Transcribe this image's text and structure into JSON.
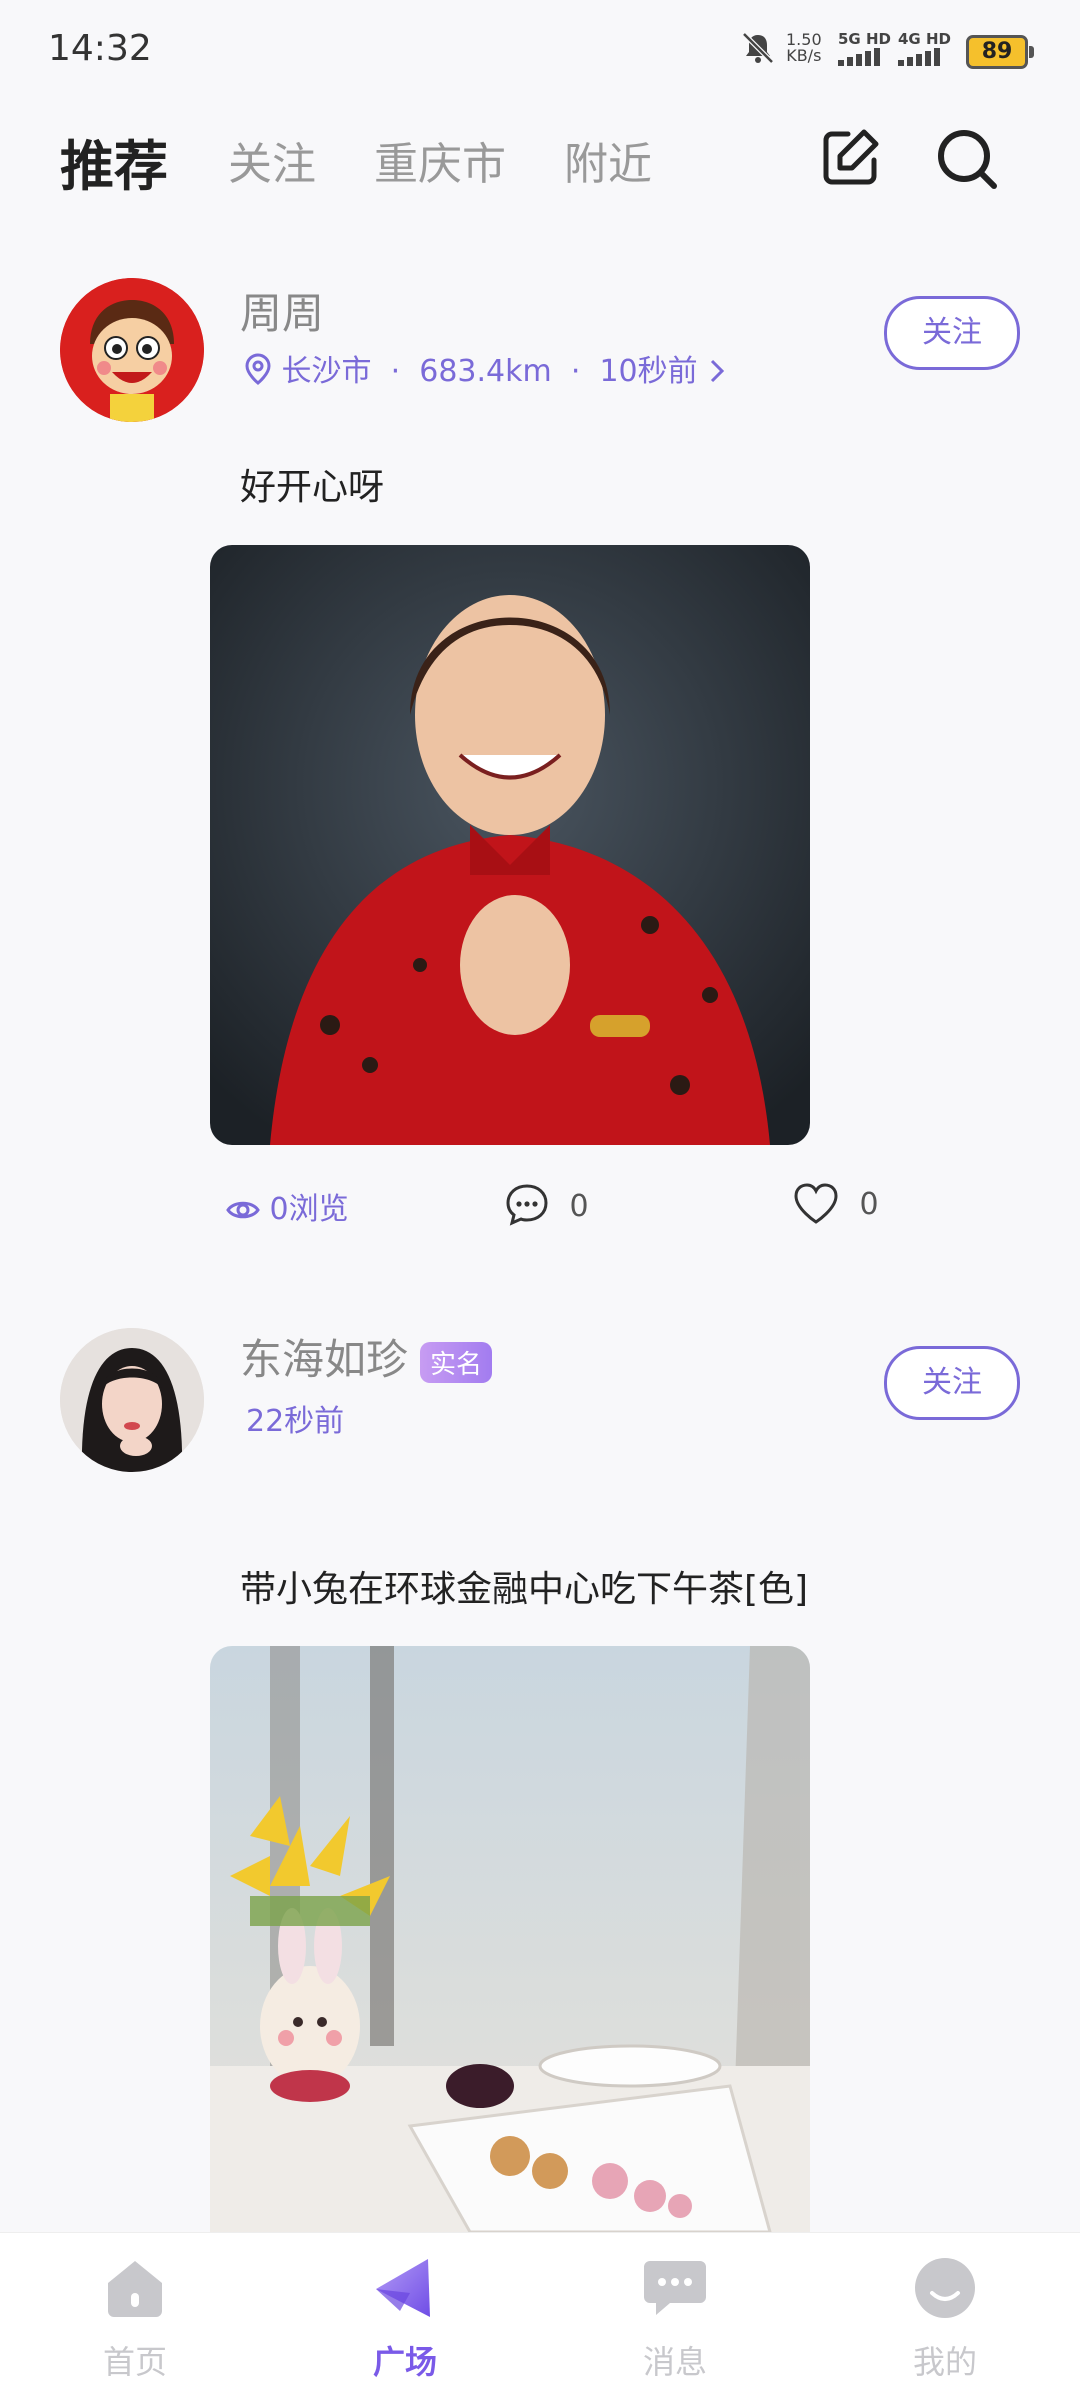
{
  "status_bar": {
    "time": "14:32",
    "net_speed_value": "1.50",
    "net_speed_unit": "KB/s",
    "net_5g": "5G HD",
    "net_4g": "4G HD",
    "battery": "89"
  },
  "top_tabs": [
    {
      "label": "推荐",
      "active": true
    },
    {
      "label": "关注",
      "active": false
    },
    {
      "label": "重庆市",
      "active": false
    },
    {
      "label": "附近",
      "active": false
    }
  ],
  "posts": [
    {
      "username": "周周",
      "location": "长沙市",
      "distance": "683.4km",
      "time_ago": "10秒前",
      "follow_label": "关注",
      "text": "好开心呀",
      "views": "0浏览",
      "comments": "0",
      "likes": "0"
    },
    {
      "username": "东海如珍",
      "badge": "实名",
      "time_ago": "22秒前",
      "follow_label": "关注",
      "text": "带小兔在环球金融中心吃下午茶[色]"
    }
  ],
  "bottom_nav": [
    {
      "label": "首页",
      "icon": "home-icon",
      "active": false
    },
    {
      "label": "广场",
      "icon": "plaza-icon",
      "active": true
    },
    {
      "label": "消息",
      "icon": "message-icon",
      "active": false
    },
    {
      "label": "我的",
      "icon": "profile-icon",
      "active": false
    }
  ],
  "colors": {
    "accent": "#7a6ad8",
    "active_nav": "#7a5ae8",
    "battery": "#f5c02c"
  }
}
